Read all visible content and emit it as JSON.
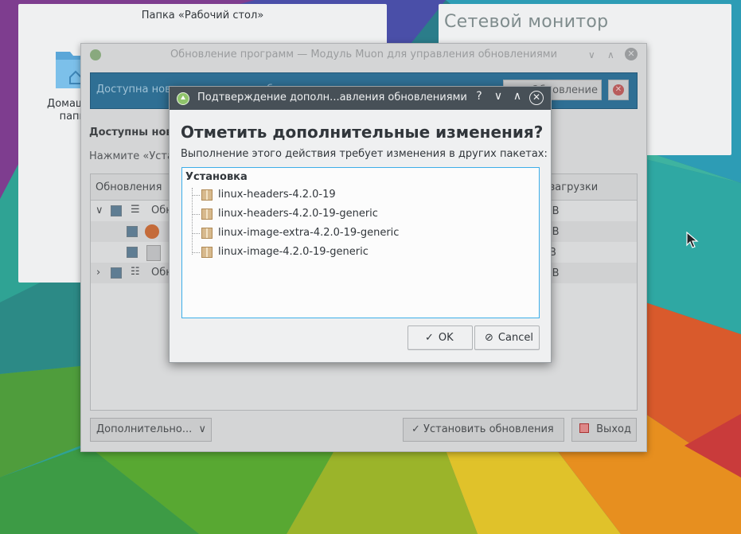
{
  "desktop": {
    "folder_widget": {
      "title": "Папка «Рабочий стол»",
      "item_label": "Домашняя папка"
    },
    "network_widget": {
      "title": "Сетевой монитор"
    }
  },
  "muon_window": {
    "title": "Обновление программ — Модуль Muon для управления обновлениями",
    "banner": {
      "text": "Доступна новая версия дистрибутива",
      "button_label": "Обновление"
    },
    "heading": "Доступны новые обновления",
    "hint": "Нажмите «Установить обновления»",
    "tree": {
      "columns": [
        "Обновления",
        "Размер загрузки"
      ],
      "header_left": "Обновления",
      "header_right": "р загрузки",
      "rows": [
        {
          "label": "Обн",
          "size": "iB"
        },
        {
          "label": "",
          "size": "iB"
        },
        {
          "label": "",
          "size": "B"
        },
        {
          "label": "Обн",
          "size": "iB"
        }
      ]
    },
    "more_button": "Дополнительно...",
    "install_button": "Установить обновления",
    "quit_button": "Выход"
  },
  "dialog": {
    "title": "Подтверждение дополн...авления обновлениями",
    "heading": "Отметить дополнительные изменения?",
    "description": "Выполнение этого действия требует изменения в других пакетах:",
    "group_label": "Установка",
    "packages": [
      "linux-headers-4.2.0-19",
      "linux-headers-4.2.0-19-generic",
      "linux-image-extra-4.2.0-19-generic",
      "linux-image-4.2.0-19-generic"
    ],
    "ok_label": "OK",
    "cancel_label": "Cancel",
    "help_glyph": "?"
  },
  "colors": {
    "dialog_titlebar": "#475057",
    "accent": "#3daee9",
    "banner": "#2f6f94"
  }
}
